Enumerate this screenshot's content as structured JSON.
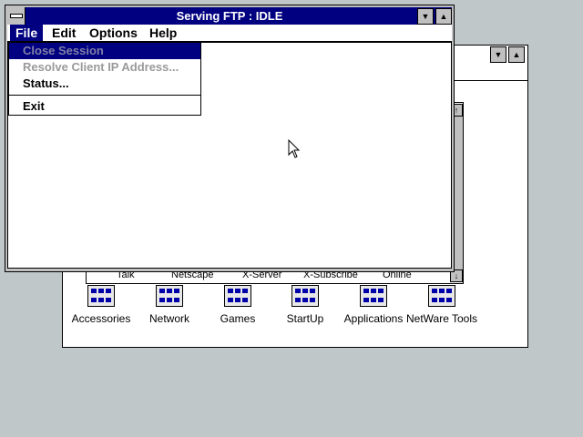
{
  "ftp_window": {
    "title": "Serving FTP : IDLE",
    "menu": [
      "File",
      "Edit",
      "Options",
      "Help"
    ],
    "file_menu": {
      "items": [
        {
          "label": "Close Session",
          "state": "disabled-selected"
        },
        {
          "label": "Resolve Client IP Address...",
          "state": "disabled"
        },
        {
          "label": "Status...",
          "state": "enabled"
        },
        {
          "label": "Exit",
          "state": "enabled"
        }
      ]
    }
  },
  "group_window": {
    "labels": [
      "Talk",
      "Netscape",
      "X-Server",
      "X-Subscribe",
      "Online"
    ]
  },
  "program_groups": [
    {
      "label": "Accessories"
    },
    {
      "label": "Network"
    },
    {
      "label": "Games"
    },
    {
      "label": "StartUp"
    },
    {
      "label": "Applications"
    },
    {
      "label": "NetWare Tools"
    }
  ],
  "colors": {
    "title_active": "#000080",
    "desktop": "#c0c7c8",
    "disabled_text": "#9a9a9a"
  },
  "icons": {
    "system_menu": "system-menu-icon",
    "minimize": "minimize-icon",
    "maximize": "maximize-icon",
    "cursor": "arrow-cursor-icon"
  }
}
